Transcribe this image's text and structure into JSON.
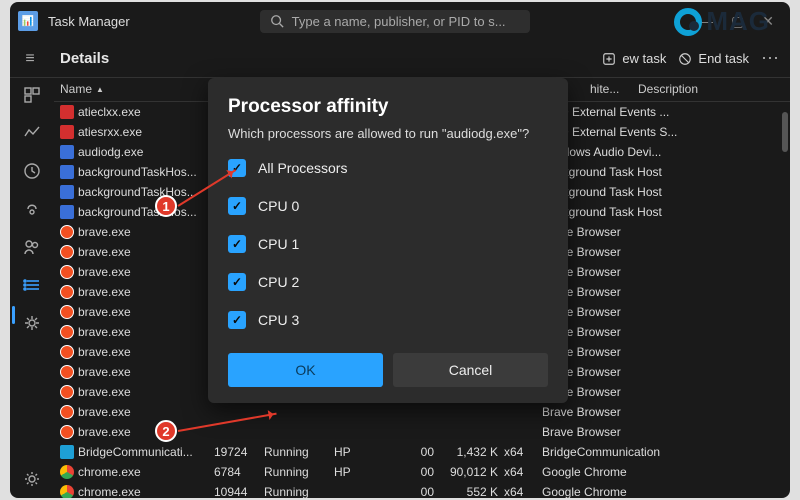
{
  "app": {
    "title": "Task Manager"
  },
  "search": {
    "placeholder": "Type a name, publisher, or PID to s..."
  },
  "section": "Details",
  "actions": {
    "new_task": "ew task",
    "end_task": "End task"
  },
  "columns": {
    "name": "Name",
    "arch": "hite...",
    "desc": "Description"
  },
  "logo_text": "MAG",
  "rows": [
    {
      "icon": "amd",
      "name": "atieclxx.exe",
      "desc": "AMD External Events ..."
    },
    {
      "icon": "amd",
      "name": "atiesrxx.exe",
      "desc": "AMD External Events S..."
    },
    {
      "icon": "win",
      "name": "audiodg.exe",
      "desc": "Windows Audio Devi..."
    },
    {
      "icon": "win",
      "name": "backgroundTaskHos...",
      "desc": "Background Task Host"
    },
    {
      "icon": "win",
      "name": "backgroundTaskHos...",
      "desc": "Background Task Host"
    },
    {
      "icon": "win",
      "name": "backgroundTaskHos...",
      "desc": "Background Task Host"
    },
    {
      "icon": "brave",
      "name": "brave.exe",
      "desc": "Brave Browser"
    },
    {
      "icon": "brave",
      "name": "brave.exe",
      "desc": "Brave Browser"
    },
    {
      "icon": "brave",
      "name": "brave.exe",
      "desc": "Brave Browser"
    },
    {
      "icon": "brave",
      "name": "brave.exe",
      "desc": "Brave Browser"
    },
    {
      "icon": "brave",
      "name": "brave.exe",
      "desc": "Brave Browser"
    },
    {
      "icon": "brave",
      "name": "brave.exe",
      "desc": "Brave Browser"
    },
    {
      "icon": "brave",
      "name": "brave.exe",
      "desc": "Brave Browser"
    },
    {
      "icon": "brave",
      "name": "brave.exe",
      "desc": "Brave Browser"
    },
    {
      "icon": "brave",
      "name": "brave.exe",
      "desc": "Brave Browser"
    },
    {
      "icon": "brave",
      "name": "brave.exe",
      "desc": "Brave Browser"
    },
    {
      "icon": "brave",
      "name": "brave.exe",
      "desc": "Brave Browser"
    },
    {
      "icon": "bridge",
      "name": "BridgeCommunicati...",
      "pid": "19724",
      "status": "Running",
      "hp": "HP",
      "cpu": "00",
      "mem": "1,432 K",
      "arch": "x64",
      "desc": "BridgeCommunication"
    },
    {
      "icon": "chrome",
      "name": "chrome.exe",
      "pid": "6784",
      "status": "Running",
      "hp": "HP",
      "cpu": "00",
      "mem": "90,012 K",
      "arch": "x64",
      "desc": "Google Chrome"
    },
    {
      "icon": "chrome",
      "name": "chrome.exe",
      "pid": "10944",
      "status": "Running",
      "hp": "",
      "cpu": "00",
      "mem": "552 K",
      "arch": "x64",
      "desc": "Google Chrome"
    }
  ],
  "dialog": {
    "title": "Processor affinity",
    "subtitle": "Which processors are allowed to run \"audiodg.exe\"?",
    "options": [
      "All Processors",
      "CPU 0",
      "CPU 1",
      "CPU 2",
      "CPU 3"
    ],
    "ok": "OK",
    "cancel": "Cancel"
  },
  "callouts": {
    "one": "1",
    "two": "2"
  }
}
